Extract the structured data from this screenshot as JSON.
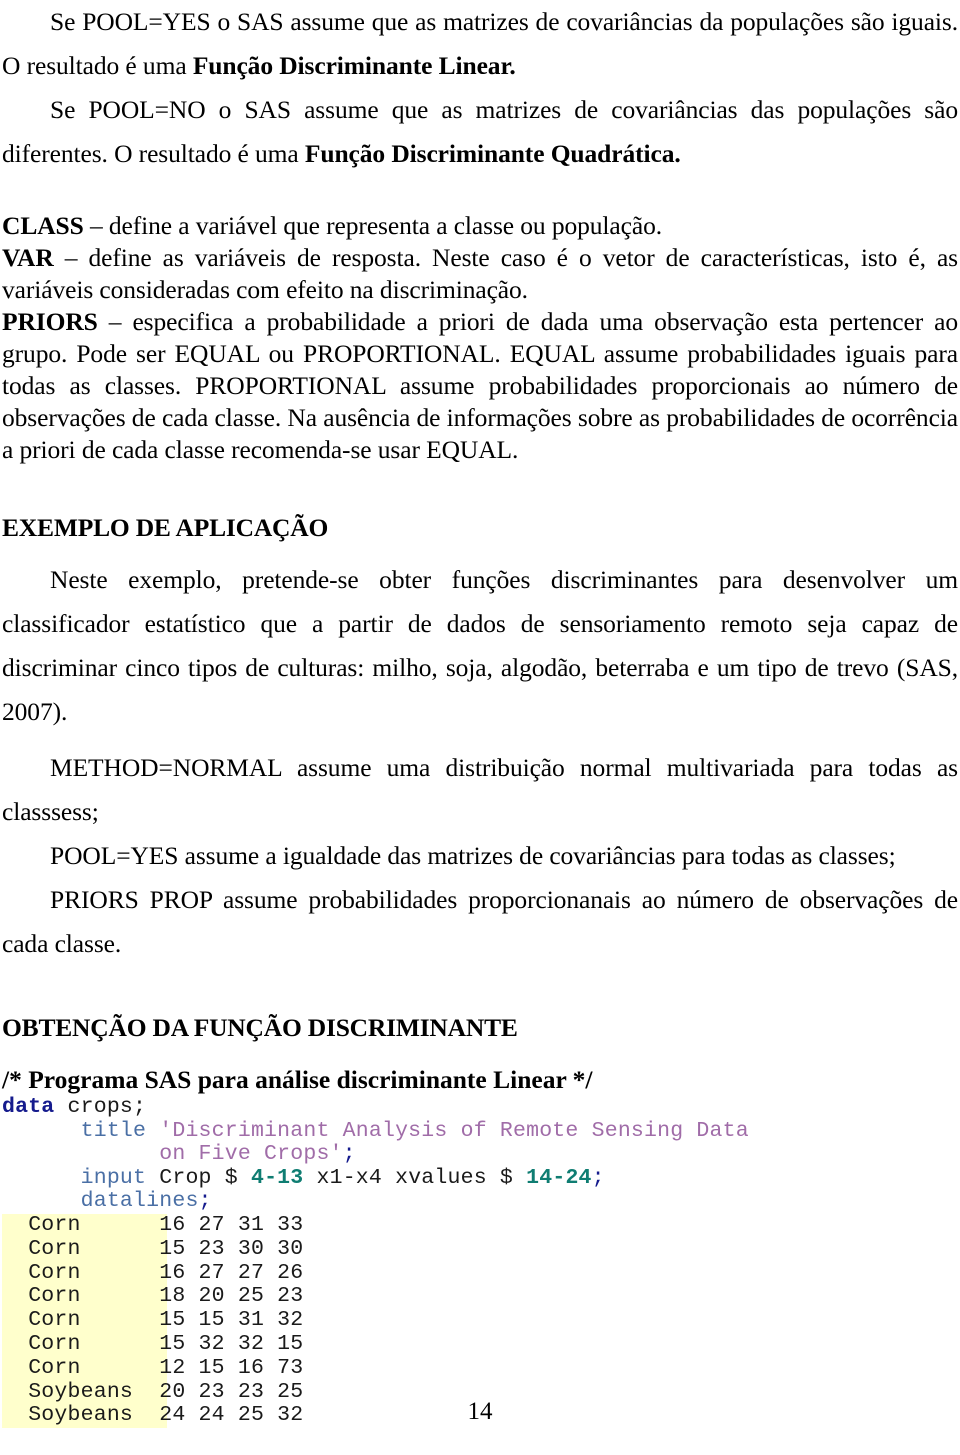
{
  "document": {
    "page_number": "14",
    "language": "pt-BR"
  },
  "intro": {
    "line1_prefix": "Se POOL=YES  o SAS assume que as matrizes de covariâncias da populações são iguais. O resultado é uma ",
    "line1_bold": "Função Discriminante Linear.",
    "line2_prefix": "Se POOL=NO o SAS assume que as matrizes de covariâncias das populações são diferentes. O resultado é uma ",
    "line2_bold": "Função Discriminante Quadrática."
  },
  "options": {
    "class_term": "CLASS",
    "class_desc": " – define a variável que representa a classe ou população.",
    "var_term": "VAR",
    "var_desc": " – define as variáveis de resposta. Neste caso é o vetor de características, isto é, as variáveis consideradas com efeito na discriminação.",
    "priors_term": "PRIORS",
    "priors_desc": " – especifica a probabilidade a priori de dada uma observação esta pertencer ao grupo. Pode ser EQUAL ou PROPORTIONAL. EQUAL assume probabilidades iguais para todas as classes. PROPORTIONAL assume probabilidades proporcionais ao número de observações de cada classe. Na ausência de informações sobre as probabilidades de ocorrência a priori de cada classe recomenda-se usar EQUAL."
  },
  "example": {
    "heading": "EXEMPLO DE APLICAÇÃO",
    "paragraph": "Neste exemplo, pretende-se obter funções discriminantes para desenvolver um classificador estatístico que a partir de dados de sensoriamento remoto seja capaz de discriminar cinco tipos de culturas: milho, soja, algodão, beterraba e um tipo de trevo (SAS, 2007).",
    "method_line": "METHOD=NORMAL assume uma distribuição normal multivariada para todas as classsess;",
    "pool_line": "POOL=YES assume a igualdade das matrizes de covariâncias para todas as classes;",
    "priors_line": "PRIORS PROP assume probabilidades proporcionanais ao número de observações de cada classe."
  },
  "code_section": {
    "heading": "OBTENÇÃO DA FUNÇÃO DISCRIMINANTE",
    "comment": "/* Programa SAS para análise discriminante Linear */",
    "lines": {
      "l1_kw": "data",
      "l1_rest": " crops;",
      "l2_indent": "      ",
      "l2_kw": "title",
      "l2_str": " 'Discriminant Analysis of Remote Sensing Data",
      "l3_indent": "            ",
      "l3_str": "on Five Crops'",
      "l3_semi": ";",
      "l4_indent": "      ",
      "l4_kw": "input",
      "l4_mid1": " Crop $ ",
      "l4_num1": "4-13",
      "l4_mid2": " x1-x4 xvalues $ ",
      "l4_num2": "14-24",
      "l4_semi": ";",
      "l5_indent": "      ",
      "l5_kw": "datalines",
      "l5_semi": ";"
    },
    "datalines": [
      "  Corn      16 27 31 33",
      "  Corn      15 23 30 30",
      "  Corn      16 27 27 26",
      "  Corn      18 20 25 23",
      "  Corn      15 15 31 32",
      "  Corn      15 32 32 15",
      "  Corn      12 15 16 73",
      "  Soybeans  20 23 23 25",
      "  Soybeans  24 24 25 32"
    ]
  },
  "colors": {
    "highlight": "#ffffcc",
    "keyword_data": "#151b8d",
    "keyword_statement": "#4a6fa5",
    "string": "#a06ca8",
    "number": "#0f7d72",
    "text": "#000000"
  }
}
